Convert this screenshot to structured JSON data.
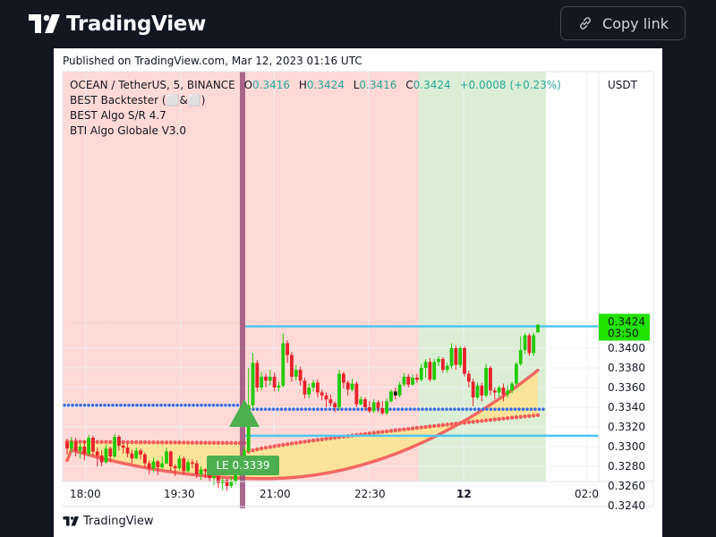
{
  "header": {
    "brand": "TradingView",
    "copy_label": "Copy link"
  },
  "published": "Published on TradingView.com, Mar 12, 2023 01:16 UTC",
  "legend": {
    "symbol": "OCEAN / TetherUS, 5, BINANCE",
    "o_label": "O",
    "o_value": "0.3416",
    "h_label": "H",
    "h_value": "0.3424",
    "l_label": "L",
    "l_value": "0.3416",
    "c_label": "C",
    "c_value": "0.3424",
    "change": "+0.0008 (+0.23%)",
    "indicators": [
      "BEST Backtester (⬜&⬜)",
      "BEST Algo S/R 4.7",
      "BTI Algo Globale V3.0"
    ]
  },
  "footer_brand": "TradingView",
  "chart_data": {
    "type": "candlestick",
    "symbol": "OCEAN / TetherUS",
    "interval": "5",
    "exchange": "BINANCE",
    "currency": "USDT",
    "x_ticks": [
      "18:00",
      "19:30",
      "21:00",
      "22:30",
      "12",
      "02:0"
    ],
    "y_ticks": [
      0.324,
      0.326,
      0.328,
      0.33,
      0.332,
      0.334,
      0.336,
      0.338,
      0.34
    ],
    "y_tick_labels": [
      "0.3240",
      "0.3260",
      "0.3280",
      "0.3300",
      "0.3320",
      "0.3340",
      "0.3360",
      "0.3380",
      "0.3400"
    ],
    "ylim": [
      0.3235,
      0.3442
    ],
    "last_price": "0.3424",
    "countdown": "03:50",
    "signal_label": "LE 0.3339",
    "candles": [
      [
        0.3304,
        0.3298,
        0.3308,
        0.3292
      ],
      [
        0.3298,
        0.3305,
        0.331,
        0.3294
      ],
      [
        0.3305,
        0.3296,
        0.3309,
        0.329
      ],
      [
        0.3296,
        0.33,
        0.3304,
        0.3288
      ],
      [
        0.33,
        0.3293,
        0.3306,
        0.3286
      ],
      [
        0.3293,
        0.3309,
        0.3312,
        0.329
      ],
      [
        0.3309,
        0.3295,
        0.3311,
        0.3291
      ],
      [
        0.3295,
        0.3291,
        0.3299,
        0.328
      ],
      [
        0.3291,
        0.3284,
        0.3296,
        0.328
      ],
      [
        0.3284,
        0.3298,
        0.3302,
        0.3283
      ],
      [
        0.3298,
        0.329,
        0.33,
        0.3284
      ],
      [
        0.329,
        0.331,
        0.3313,
        0.3288
      ],
      [
        0.331,
        0.3301,
        0.3312,
        0.3296
      ],
      [
        0.3301,
        0.3299,
        0.3304,
        0.3293
      ],
      [
        0.3299,
        0.3293,
        0.3303,
        0.3289
      ],
      [
        0.3293,
        0.3288,
        0.3297,
        0.3283
      ],
      [
        0.3288,
        0.3296,
        0.3299,
        0.3287
      ],
      [
        0.3296,
        0.3292,
        0.3298,
        0.3287
      ],
      [
        0.3292,
        0.3283,
        0.3294,
        0.3279
      ],
      [
        0.3283,
        0.3278,
        0.3286,
        0.3272
      ],
      [
        0.3278,
        0.3285,
        0.3289,
        0.3274
      ],
      [
        0.3285,
        0.3279,
        0.3286,
        0.3271
      ],
      [
        0.3279,
        0.3283,
        0.329,
        0.3277
      ],
      [
        0.3283,
        0.3295,
        0.3299,
        0.3282
      ],
      [
        0.3295,
        0.328,
        0.3296,
        0.3275
      ],
      [
        0.328,
        0.3278,
        0.3282,
        0.327
      ],
      [
        0.3278,
        0.3288,
        0.3291,
        0.3276
      ],
      [
        0.3288,
        0.3275,
        0.329,
        0.3272
      ],
      [
        0.3275,
        0.3284,
        0.3287,
        0.3274
      ],
      [
        0.3284,
        0.3283,
        0.3287,
        0.3278
      ],
      [
        0.3283,
        0.3272,
        0.3286,
        0.3268
      ],
      [
        0.3272,
        0.3277,
        0.328,
        0.3266
      ],
      [
        0.3277,
        0.3275,
        0.3278,
        0.3268
      ],
      [
        0.3275,
        0.3268,
        0.3279,
        0.3264
      ],
      [
        0.3268,
        0.327,
        0.3276,
        0.3261
      ],
      [
        0.327,
        0.3263,
        0.3272,
        0.3258
      ],
      [
        0.3263,
        0.3266,
        0.3268,
        0.3256
      ],
      [
        0.3266,
        0.326,
        0.3268,
        0.3255
      ],
      [
        0.326,
        0.3265,
        0.327,
        0.3258
      ],
      [
        0.3265,
        0.3272,
        0.3276,
        0.3262
      ],
      [
        0.3272,
        0.3286,
        0.329,
        0.327
      ],
      [
        0.3286,
        0.3296,
        0.33,
        0.3284
      ],
      [
        0.3296,
        0.3342,
        0.338,
        0.3294
      ],
      [
        0.3342,
        0.3385,
        0.3395,
        0.3338
      ],
      [
        0.3385,
        0.336,
        0.3388,
        0.3356
      ],
      [
        0.336,
        0.3371,
        0.3376,
        0.3357
      ],
      [
        0.3371,
        0.3367,
        0.3374,
        0.336
      ],
      [
        0.3367,
        0.3371,
        0.3378,
        0.3362
      ],
      [
        0.3371,
        0.336,
        0.3375,
        0.3356
      ],
      [
        0.336,
        0.3362,
        0.3366,
        0.3356
      ],
      [
        0.3362,
        0.3405,
        0.3415,
        0.336
      ],
      [
        0.3405,
        0.3393,
        0.3408,
        0.3385
      ],
      [
        0.3393,
        0.3371,
        0.3396,
        0.3366
      ],
      [
        0.3371,
        0.3378,
        0.3383,
        0.3367
      ],
      [
        0.3378,
        0.3367,
        0.3381,
        0.3362
      ],
      [
        0.3367,
        0.3353,
        0.337,
        0.3349
      ],
      [
        0.3353,
        0.336,
        0.3364,
        0.3349
      ],
      [
        0.336,
        0.3365,
        0.3368,
        0.3356
      ],
      [
        0.3365,
        0.3355,
        0.3368,
        0.335
      ],
      [
        0.3355,
        0.3352,
        0.3358,
        0.3347
      ],
      [
        0.3352,
        0.3348,
        0.3355,
        0.334
      ],
      [
        0.3348,
        0.3344,
        0.3353,
        0.3341
      ],
      [
        0.3344,
        0.334,
        0.3346,
        0.3335
      ],
      [
        0.334,
        0.3374,
        0.3378,
        0.3337
      ],
      [
        0.3374,
        0.3365,
        0.3376,
        0.3359
      ],
      [
        0.3365,
        0.3358,
        0.3367,
        0.3352
      ],
      [
        0.3358,
        0.3364,
        0.3369,
        0.3356
      ],
      [
        0.3364,
        0.3343,
        0.3366,
        0.334
      ],
      [
        0.3343,
        0.3348,
        0.3351,
        0.3342
      ],
      [
        0.3348,
        0.334,
        0.335,
        0.3337
      ],
      [
        0.334,
        0.3336,
        0.3346,
        0.3334
      ],
      [
        0.3336,
        0.3345,
        0.3348,
        0.3334
      ],
      [
        0.3345,
        0.3339,
        0.3347,
        0.3335
      ],
      [
        0.3339,
        0.3334,
        0.3346,
        0.3332
      ],
      [
        0.3334,
        0.3346,
        0.3349,
        0.3332
      ],
      [
        0.3346,
        0.3356,
        0.3358,
        0.3345
      ],
      [
        0.3356,
        0.3352,
        0.336,
        0.3348
      ],
      [
        0.3352,
        0.3363,
        0.3366,
        0.335
      ],
      [
        0.3363,
        0.3371,
        0.3375,
        0.3361
      ],
      [
        0.3371,
        0.3363,
        0.3374,
        0.336
      ],
      [
        0.3363,
        0.337,
        0.3373,
        0.3362
      ],
      [
        0.337,
        0.3368,
        0.3374,
        0.3365
      ],
      [
        0.3368,
        0.338,
        0.3384,
        0.3366
      ],
      [
        0.338,
        0.3386,
        0.3389,
        0.337
      ],
      [
        0.3386,
        0.3368,
        0.339,
        0.3366
      ],
      [
        0.3368,
        0.3386,
        0.3389,
        0.3367
      ],
      [
        0.3386,
        0.3389,
        0.3392,
        0.3382
      ],
      [
        0.3389,
        0.3378,
        0.3391,
        0.3375
      ],
      [
        0.3378,
        0.3382,
        0.3385,
        0.3375
      ],
      [
        0.3382,
        0.34,
        0.3405,
        0.3379
      ],
      [
        0.34,
        0.3383,
        0.3403,
        0.3378
      ],
      [
        0.3383,
        0.34,
        0.3402,
        0.338
      ],
      [
        0.34,
        0.3374,
        0.3402,
        0.3371
      ],
      [
        0.3374,
        0.3366,
        0.3377,
        0.336
      ],
      [
        0.3366,
        0.335,
        0.3369,
        0.3341
      ],
      [
        0.335,
        0.3362,
        0.3365,
        0.3348
      ],
      [
        0.3362,
        0.3352,
        0.3365,
        0.3346
      ],
      [
        0.3352,
        0.338,
        0.3384,
        0.335
      ],
      [
        0.338,
        0.3357,
        0.3382,
        0.3352
      ],
      [
        0.3357,
        0.3355,
        0.336,
        0.3348
      ],
      [
        0.3355,
        0.336,
        0.3362,
        0.335
      ],
      [
        0.336,
        0.3353,
        0.3364,
        0.3346
      ],
      [
        0.3353,
        0.3357,
        0.3362,
        0.335
      ],
      [
        0.3357,
        0.3364,
        0.3366,
        0.3354
      ],
      [
        0.3364,
        0.3384,
        0.3386,
        0.3362
      ],
      [
        0.3384,
        0.3398,
        0.3412,
        0.3382
      ],
      [
        0.3398,
        0.3413,
        0.3415,
        0.3394
      ],
      [
        0.3413,
        0.3395,
        0.3415,
        0.3392
      ],
      [
        0.3395,
        0.3413,
        0.3416,
        0.3392
      ],
      [
        0.3416,
        0.3424,
        0.3424,
        0.3416
      ]
    ],
    "levels": {
      "resistance": 0.3424,
      "support_upper": 0.3338,
      "support_left": 0.3342,
      "lower_line": 0.3311
    }
  },
  "colors": {
    "up": "#22c900",
    "down": "#e8212b",
    "bg_red": "#ffd9d6",
    "bg_green": "#dcefd6",
    "fill": "#fbe49a",
    "fast_ma": "#f15a59",
    "blue_line": "#4dc7f0",
    "dots": "#3d6fe2",
    "vline": "#9b4f7d",
    "signal": "#4caf50",
    "price_label": "#22e200"
  }
}
